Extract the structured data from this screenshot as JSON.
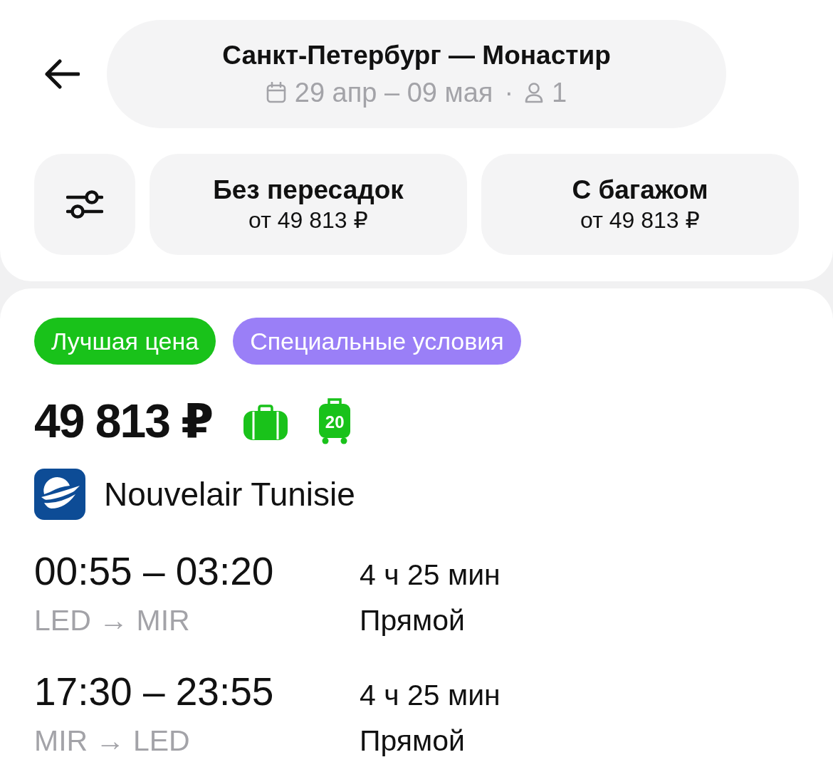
{
  "header": {
    "route": "Санкт-Петербург — Монастир",
    "dates": "29 апр – 09 мая",
    "separator": "·",
    "passengers": "1"
  },
  "filters": [
    {
      "title": "Без пересадок",
      "price": "от 49 813 ₽"
    },
    {
      "title": "С багажом",
      "price": "от 49 813 ₽"
    }
  ],
  "badges": [
    {
      "label": "Лучшая цена",
      "color": "#19c21a"
    },
    {
      "label": "Специальные условия",
      "color": "#9a7ff7"
    }
  ],
  "price": "49 813 ₽",
  "baggage": [
    {
      "kind": "hand"
    },
    {
      "kind": "checked",
      "weight": "20"
    }
  ],
  "airline": {
    "name": "Nouvelair Tunisie"
  },
  "segments": [
    {
      "times": "00:55 – 03:20",
      "route": "LED → MIR",
      "duration": "4 ч 25 мин",
      "stops": "Прямой"
    },
    {
      "times": "17:30 – 23:55",
      "route": "MIR → LED",
      "duration": "4 ч 25 мин",
      "stops": "Прямой"
    }
  ]
}
